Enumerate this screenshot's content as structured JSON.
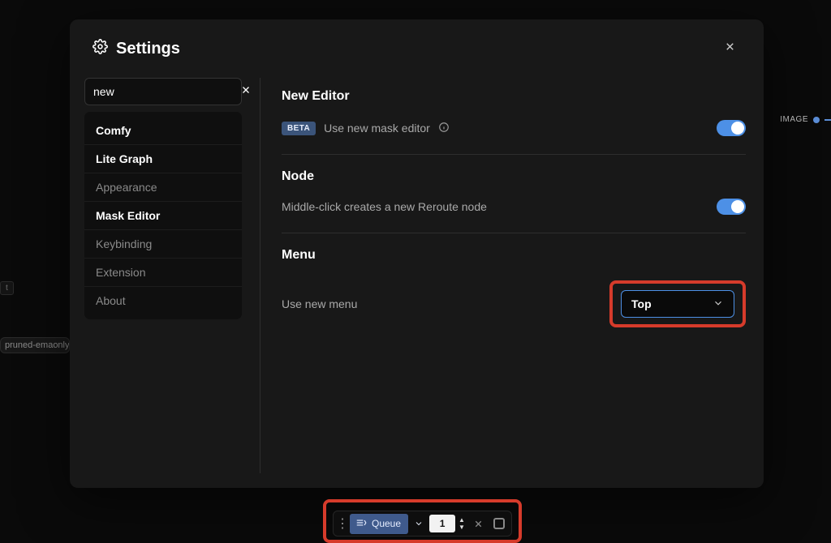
{
  "background": {
    "node_label": "t",
    "node_file_text": "pruned-emaonly-fp",
    "image_port_label": "IMAGE"
  },
  "modal": {
    "title": "Settings",
    "search": {
      "value": "new"
    },
    "sidebar": {
      "items": [
        {
          "label": "Comfy",
          "highlight": true
        },
        {
          "label": "Lite Graph",
          "highlight": true
        },
        {
          "label": "Appearance",
          "highlight": false
        },
        {
          "label": "Mask Editor",
          "highlight": true
        },
        {
          "label": "Keybinding",
          "highlight": false
        },
        {
          "label": "Extension",
          "highlight": false
        },
        {
          "label": "About",
          "highlight": false
        }
      ]
    },
    "sections": {
      "new_editor": {
        "heading": "New Editor",
        "badge": "BETA",
        "desc": "Use new mask editor",
        "enabled": true
      },
      "node": {
        "heading": "Node",
        "desc": "Middle-click creates a new Reroute node",
        "enabled": true
      },
      "menu": {
        "heading": "Menu",
        "label": "Use new menu",
        "selected": "Top"
      }
    }
  },
  "toolbar": {
    "queue_label": "Queue",
    "count": "1"
  }
}
